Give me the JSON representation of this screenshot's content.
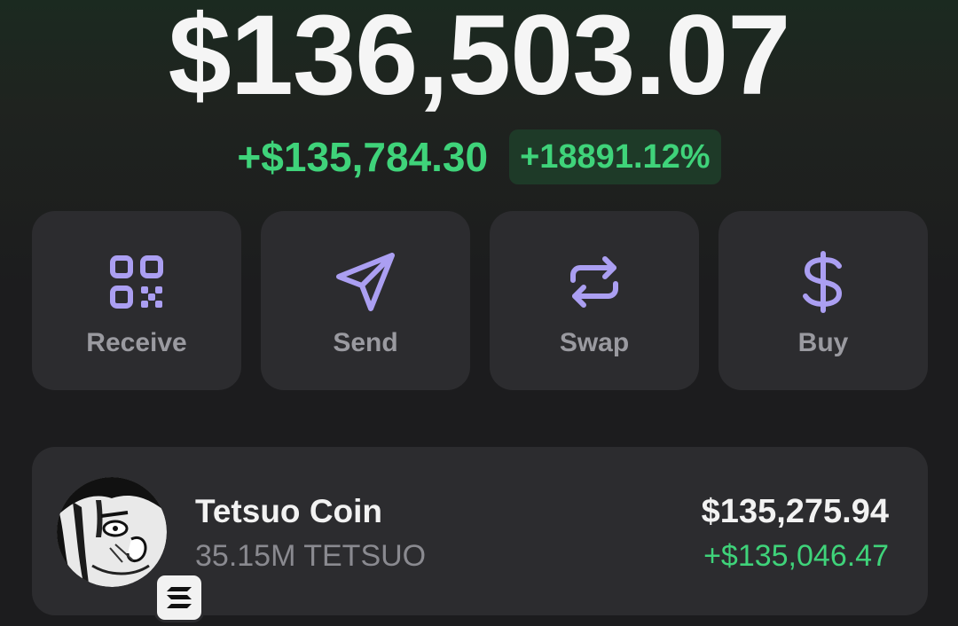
{
  "balance": {
    "total": "$136,503.07",
    "change_amount": "+$135,784.30",
    "change_percent": "+18891.12%"
  },
  "actions": [
    {
      "label": "Receive",
      "icon": "qr-code-icon"
    },
    {
      "label": "Send",
      "icon": "send-icon"
    },
    {
      "label": "Swap",
      "icon": "swap-icon"
    },
    {
      "label": "Buy",
      "icon": "dollar-icon"
    }
  ],
  "tokens": [
    {
      "name": "Tetsuo Coin",
      "amount": "35.15M TETSUO",
      "value": "$135,275.94",
      "change": "+$135,046.47",
      "chain_icon": "solana-icon"
    }
  ],
  "colors": {
    "accent": "#ab9ff2",
    "positive": "#3fd37a",
    "card": "#2c2c2f",
    "background": "#1c1c1e"
  }
}
